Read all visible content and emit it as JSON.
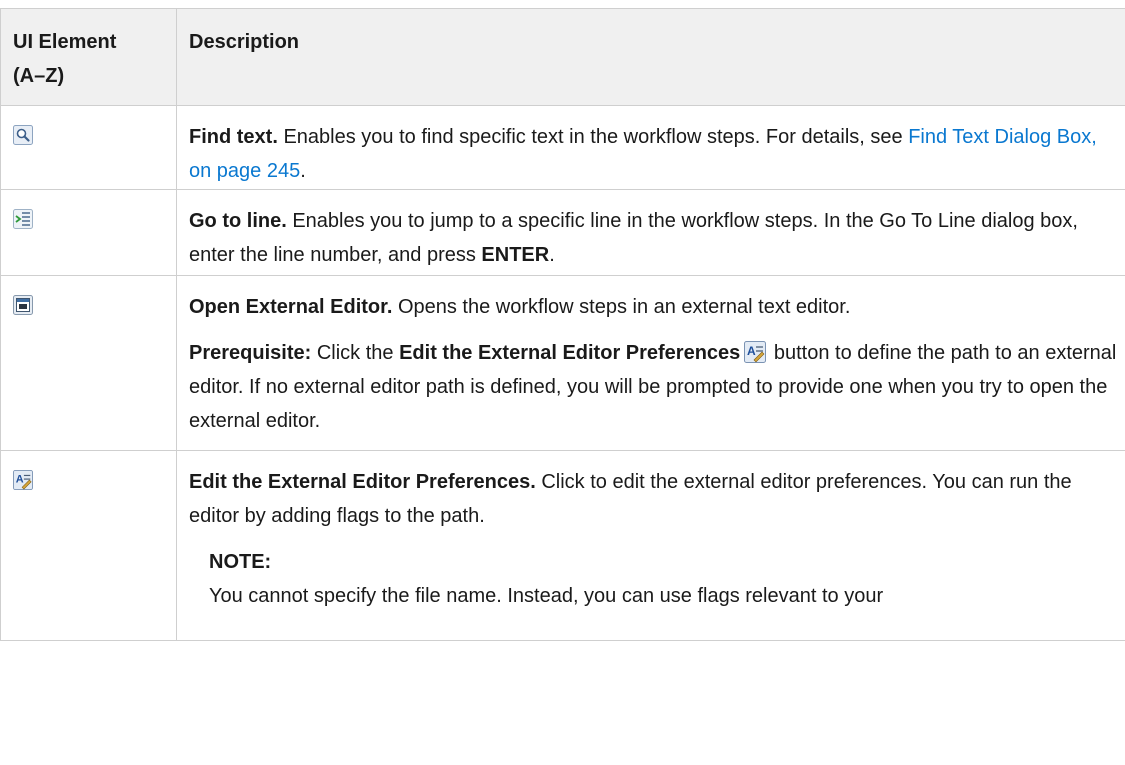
{
  "header": {
    "col1": "UI Element",
    "col1_sub": "(A–Z)",
    "col2": "Description"
  },
  "rows": [
    {
      "icon": "search-icon",
      "title": "Find text.",
      "text": " Enables you to find specific text in the workflow steps. For details, see ",
      "link": "Find Text Dialog Box, on page 245",
      "after": "."
    },
    {
      "icon": "go-to-line-icon",
      "title": "Go to line.",
      "text": " Enables you to jump to a specific line in the workflow steps. In the Go To Line dialog box, enter the line number, and press ",
      "key": "ENTER",
      "after": "."
    },
    {
      "icon": "external-editor-icon",
      "title": "Open External Editor.",
      "text": " Opens the workflow steps in an external text editor.",
      "prereq_label": "Prerequisite:",
      "prereq_pre": " Click the ",
      "prereq_button": "Edit the External Editor Preferences",
      "prereq_post": " button to define the path to an external editor. If no external editor path is defined, you will be prompted to provide one when you try to open the external editor."
    },
    {
      "icon": "editor-preferences-icon",
      "title": "Edit the External Editor Preferences.",
      "text": " Click to edit the external editor preferences. You can run the editor by adding flags to the path.",
      "note_label": "NOTE:",
      "note_text": "You cannot specify the file name. Instead, you can use flags relevant to your"
    }
  ],
  "colors": {
    "link": "#0a78d0",
    "header_bg": "#f0f0f0",
    "border": "#cfcfcf"
  }
}
